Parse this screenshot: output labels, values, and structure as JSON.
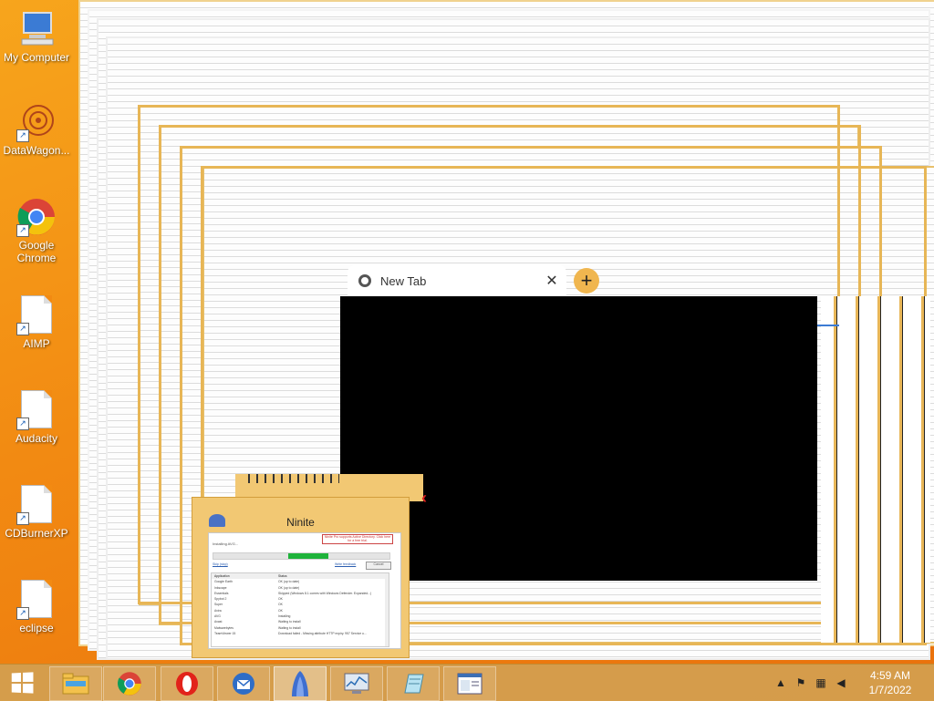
{
  "desktop": {
    "icons": [
      {
        "label": "My Computer",
        "icon": "computer-icon"
      },
      {
        "label": "DataWagon...",
        "icon": "datawagon-icon"
      },
      {
        "label": "Google Chrome",
        "icon": "chrome-icon"
      },
      {
        "label": "AIMP",
        "icon": "file-icon"
      },
      {
        "label": "Audacity",
        "icon": "file-icon"
      },
      {
        "label": "CDBurnerXP",
        "icon": "file-icon"
      },
      {
        "label": "eclipse",
        "icon": "file-icon"
      }
    ]
  },
  "browser": {
    "tab_title": "New Tab",
    "close_glyph": "✕",
    "new_tab_glyph": "+"
  },
  "ninite": {
    "title": "Ninite",
    "banner": "Ninite Pro supports Active Directory. Click here for a free trial.",
    "status": "Installing AVG...",
    "progress": 0.23,
    "skip_link": "Skip (stop)",
    "feedback_link": "Write feedback",
    "cancel_button": "Cancel",
    "columns": [
      "Application",
      "Status"
    ],
    "rows": [
      {
        "app": "Google Earth",
        "status": "OK (up to date)"
      },
      {
        "app": "Inkscape",
        "status": "OK (up to date)"
      },
      {
        "app": "Essentials",
        "status": "Skipped (Windows 8.1 comes with Windows Defender. Expanded...)"
      },
      {
        "app": "Spybot 2",
        "status": "OK"
      },
      {
        "app": "Super",
        "status": "OK"
      },
      {
        "app": "Avira",
        "status": "OK"
      },
      {
        "app": "AVG",
        "status": "Installing"
      },
      {
        "app": "Avast",
        "status": "Waiting to install"
      },
      {
        "app": "Malwarebytes",
        "status": "Waiting to install"
      },
      {
        "app": "TeamViewer 15",
        "status": "Download failed - Missing attribute HTTP expiry. 957 Service u..."
      }
    ]
  },
  "taskbar": {
    "buttons": [
      {
        "name": "file-explorer",
        "icon": "folder-icon"
      },
      {
        "name": "chrome",
        "icon": "chrome-icon"
      },
      {
        "name": "opera",
        "icon": "opera-icon"
      },
      {
        "name": "thunderbird",
        "icon": "thunderbird-icon"
      },
      {
        "name": "ninite",
        "icon": "ninite-icon"
      },
      {
        "name": "task-manager",
        "icon": "monitor-chart-icon"
      },
      {
        "name": "notepad",
        "icon": "notepad-icon"
      },
      {
        "name": "window",
        "icon": "window-icon"
      }
    ],
    "time": "4:59 AM",
    "date": "1/7/2022"
  }
}
